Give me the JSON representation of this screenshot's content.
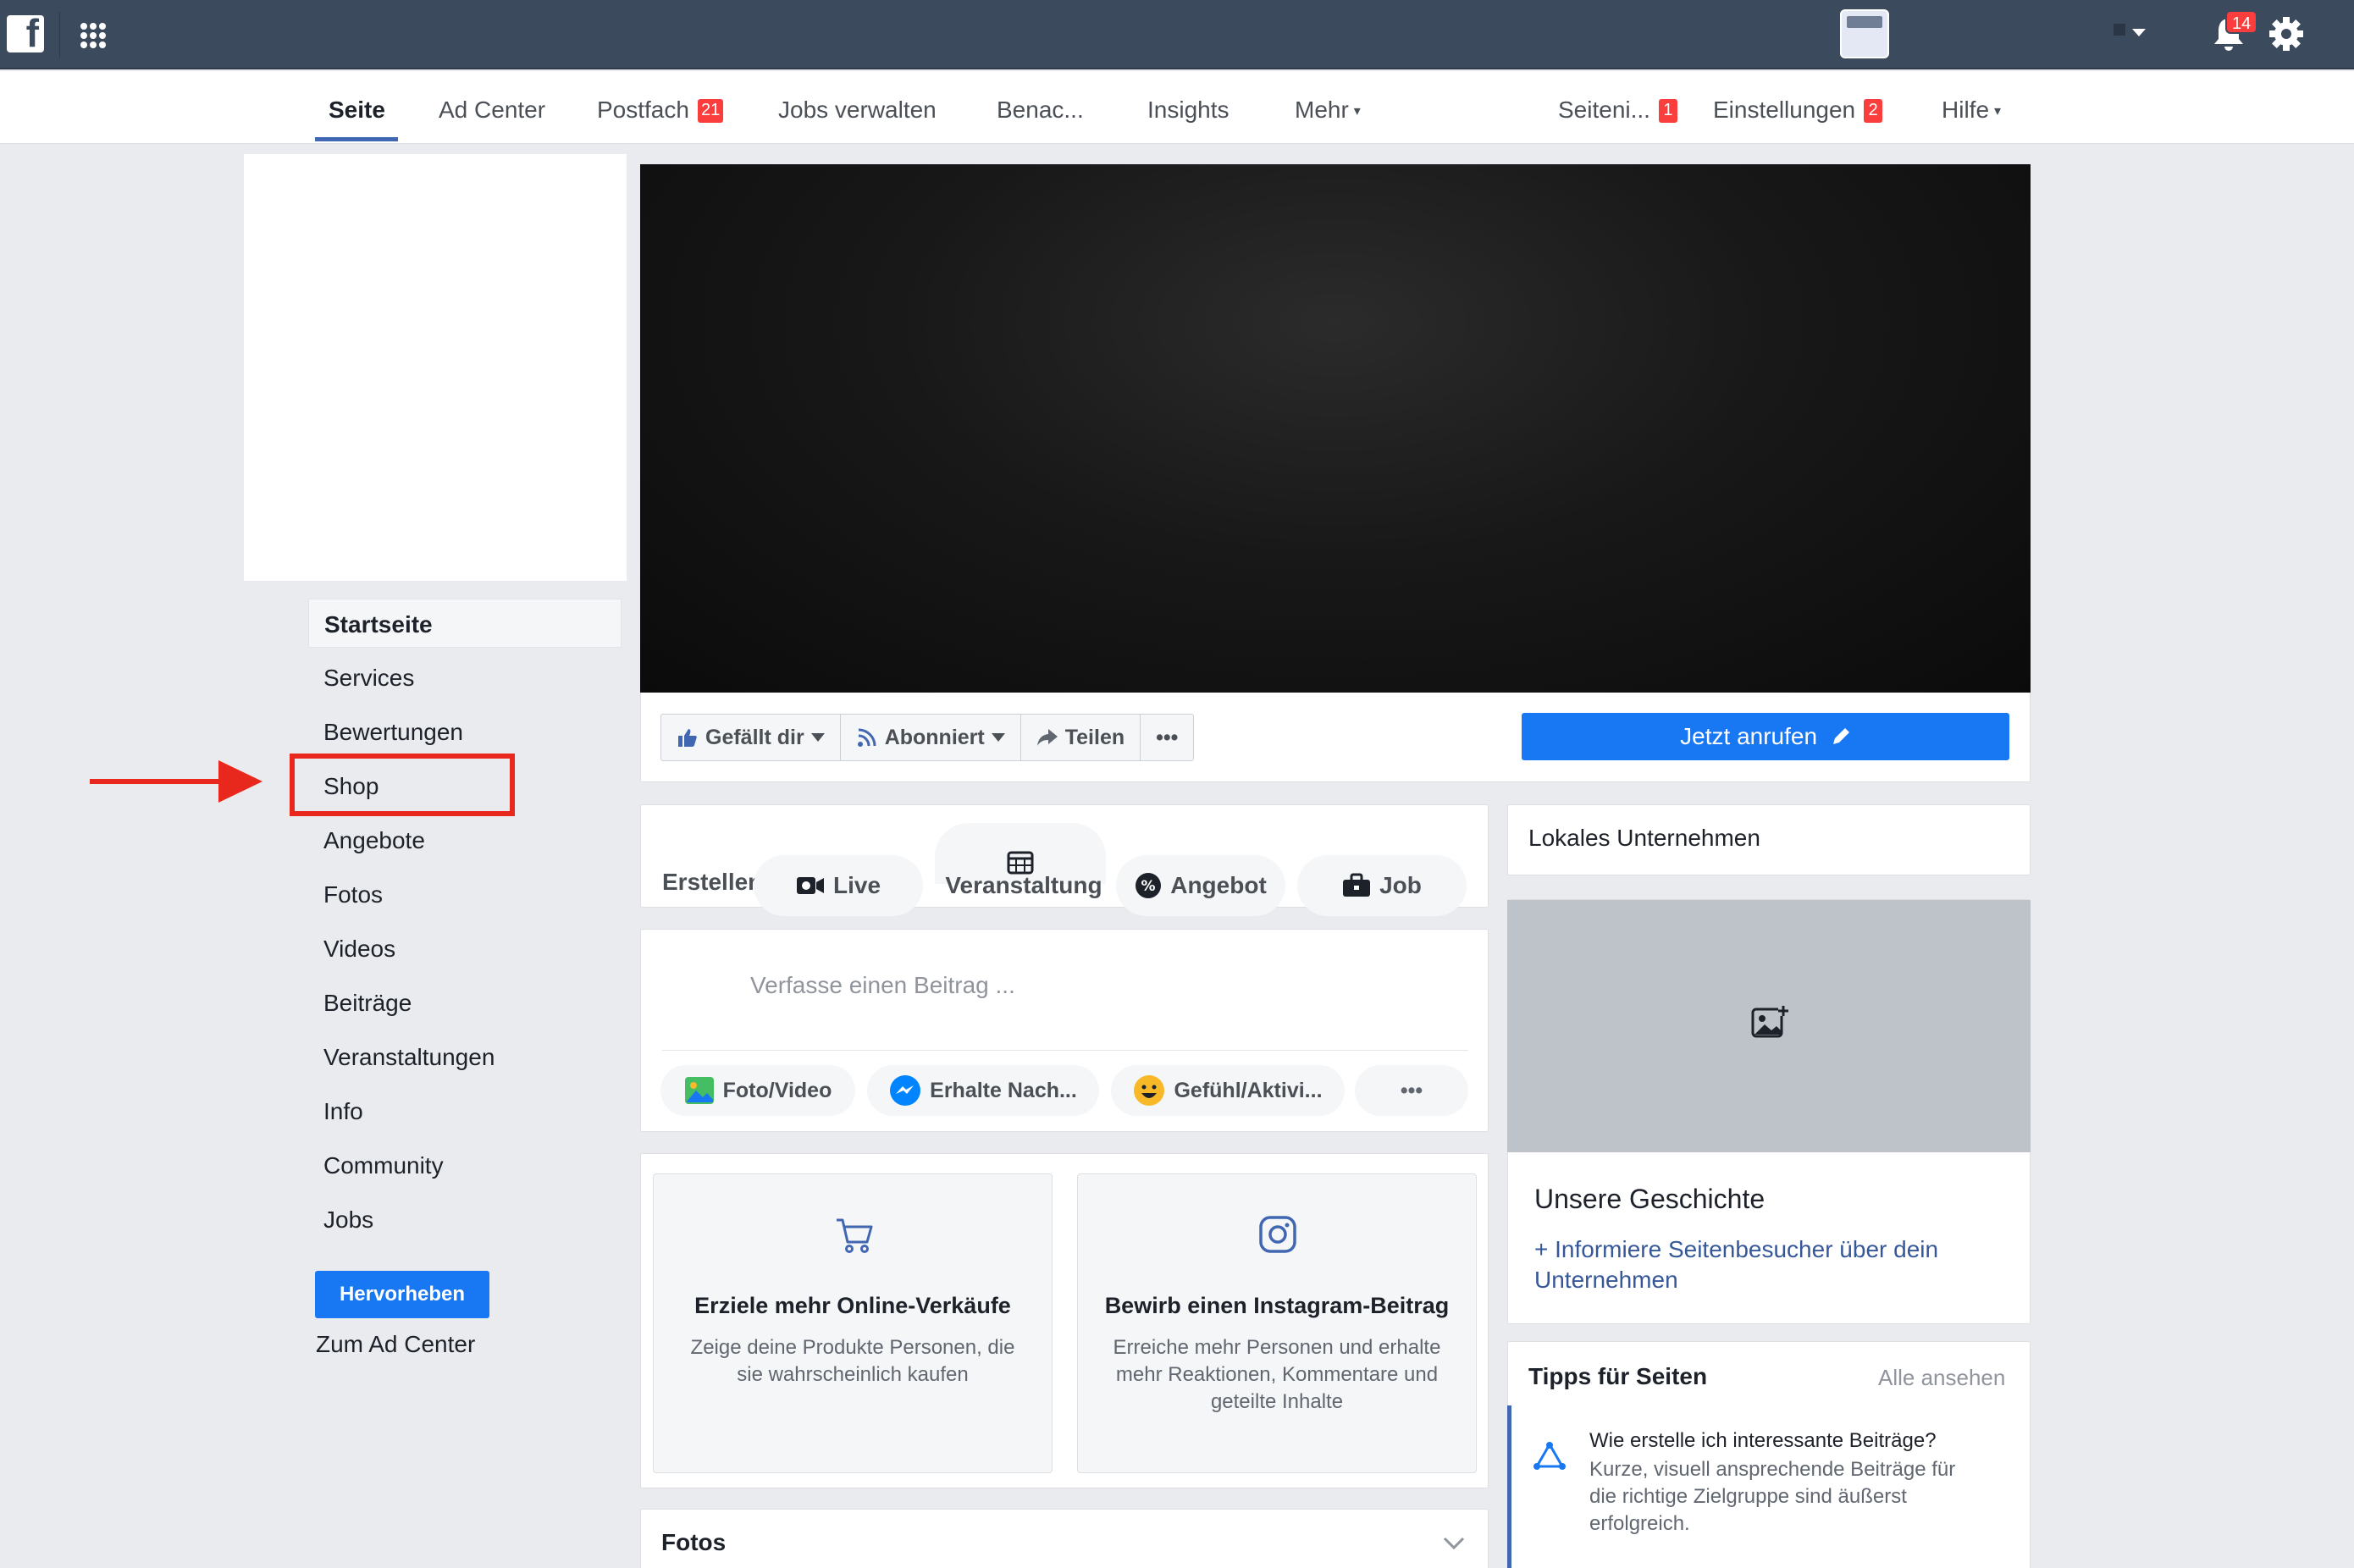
{
  "topbar": {
    "logo_letter": "f",
    "notifications_count": "14",
    "icons": [
      "facebook-logo",
      "apps-grid-icon",
      "page-thumbnail",
      "account-dropdown-icon",
      "bell-icon",
      "gear-icon"
    ]
  },
  "subnav": {
    "items": [
      {
        "label": "Seite",
        "active": true
      },
      {
        "label": "Ad Center"
      },
      {
        "label": "Postfach",
        "badge": "21"
      },
      {
        "label": "Jobs verwalten"
      },
      {
        "label": "Benac..."
      },
      {
        "label": "Insights"
      },
      {
        "label": "Mehr",
        "caret": "▾"
      }
    ],
    "right_items": [
      {
        "label": "Seiteni...",
        "badge": "1"
      },
      {
        "label": "Einstellungen",
        "badge": "2"
      },
      {
        "label": "Hilfe",
        "caret": "▾"
      }
    ]
  },
  "sidebar": {
    "items": [
      {
        "label": "Startseite",
        "active": true
      },
      {
        "label": "Services"
      },
      {
        "label": "Bewertungen"
      },
      {
        "label": "Shop",
        "highlighted": true
      },
      {
        "label": "Angebote"
      },
      {
        "label": "Fotos"
      },
      {
        "label": "Videos"
      },
      {
        "label": "Beiträge"
      },
      {
        "label": "Veranstaltungen"
      },
      {
        "label": "Info"
      },
      {
        "label": "Community"
      },
      {
        "label": "Jobs"
      }
    ],
    "promote_label": "Hervorheben",
    "ad_center_label": "Zum Ad Center"
  },
  "actions": {
    "like": "Gefällt dir",
    "subscribe": "Abonniert",
    "share": "Teilen",
    "more": "•••",
    "call": "Jetzt anrufen"
  },
  "composer": {
    "create_label": "Erstellen",
    "tabs": [
      "Live",
      "Veranstaltung",
      "Angebot",
      "Job"
    ],
    "placeholder": "Verfasse einen Beitrag ...",
    "options": [
      "Foto/Video",
      "Erhalte Nach...",
      "Gefühl/Aktivi...",
      "•••"
    ]
  },
  "promos": [
    {
      "title": "Erziele mehr Online-Verkäufe",
      "text": "Zeige deine Produkte Personen, die sie wahrscheinlich kaufen",
      "icon": "cart-icon"
    },
    {
      "title": "Bewirb einen Instagram-Beitrag",
      "text": "Erreiche mehr Personen und erhalte mehr Reaktionen, Kommentare und geteilte Inhalte",
      "icon": "instagram-icon"
    }
  ],
  "right": {
    "category": "Lokales Unternehmen",
    "story_title": "Unsere Geschichte",
    "story_link": "+ Informiere Seitenbesucher über dein Unternehmen",
    "tips_title": "Tipps für Seiten",
    "tips_all": "Alle ansehen",
    "tip_head": "Wie erstelle ich interessante Beiträge?",
    "tip_body": "Kurze, visuell ansprechende Beiträge für die richtige Zielgruppe sind äußerst erfolgreich."
  },
  "photos_section": {
    "title": "Fotos"
  },
  "colors": {
    "topbar": "#3b4a5c",
    "accent": "#1877f2",
    "highlight": "#e8281d",
    "badge": "#fa3e3e"
  }
}
